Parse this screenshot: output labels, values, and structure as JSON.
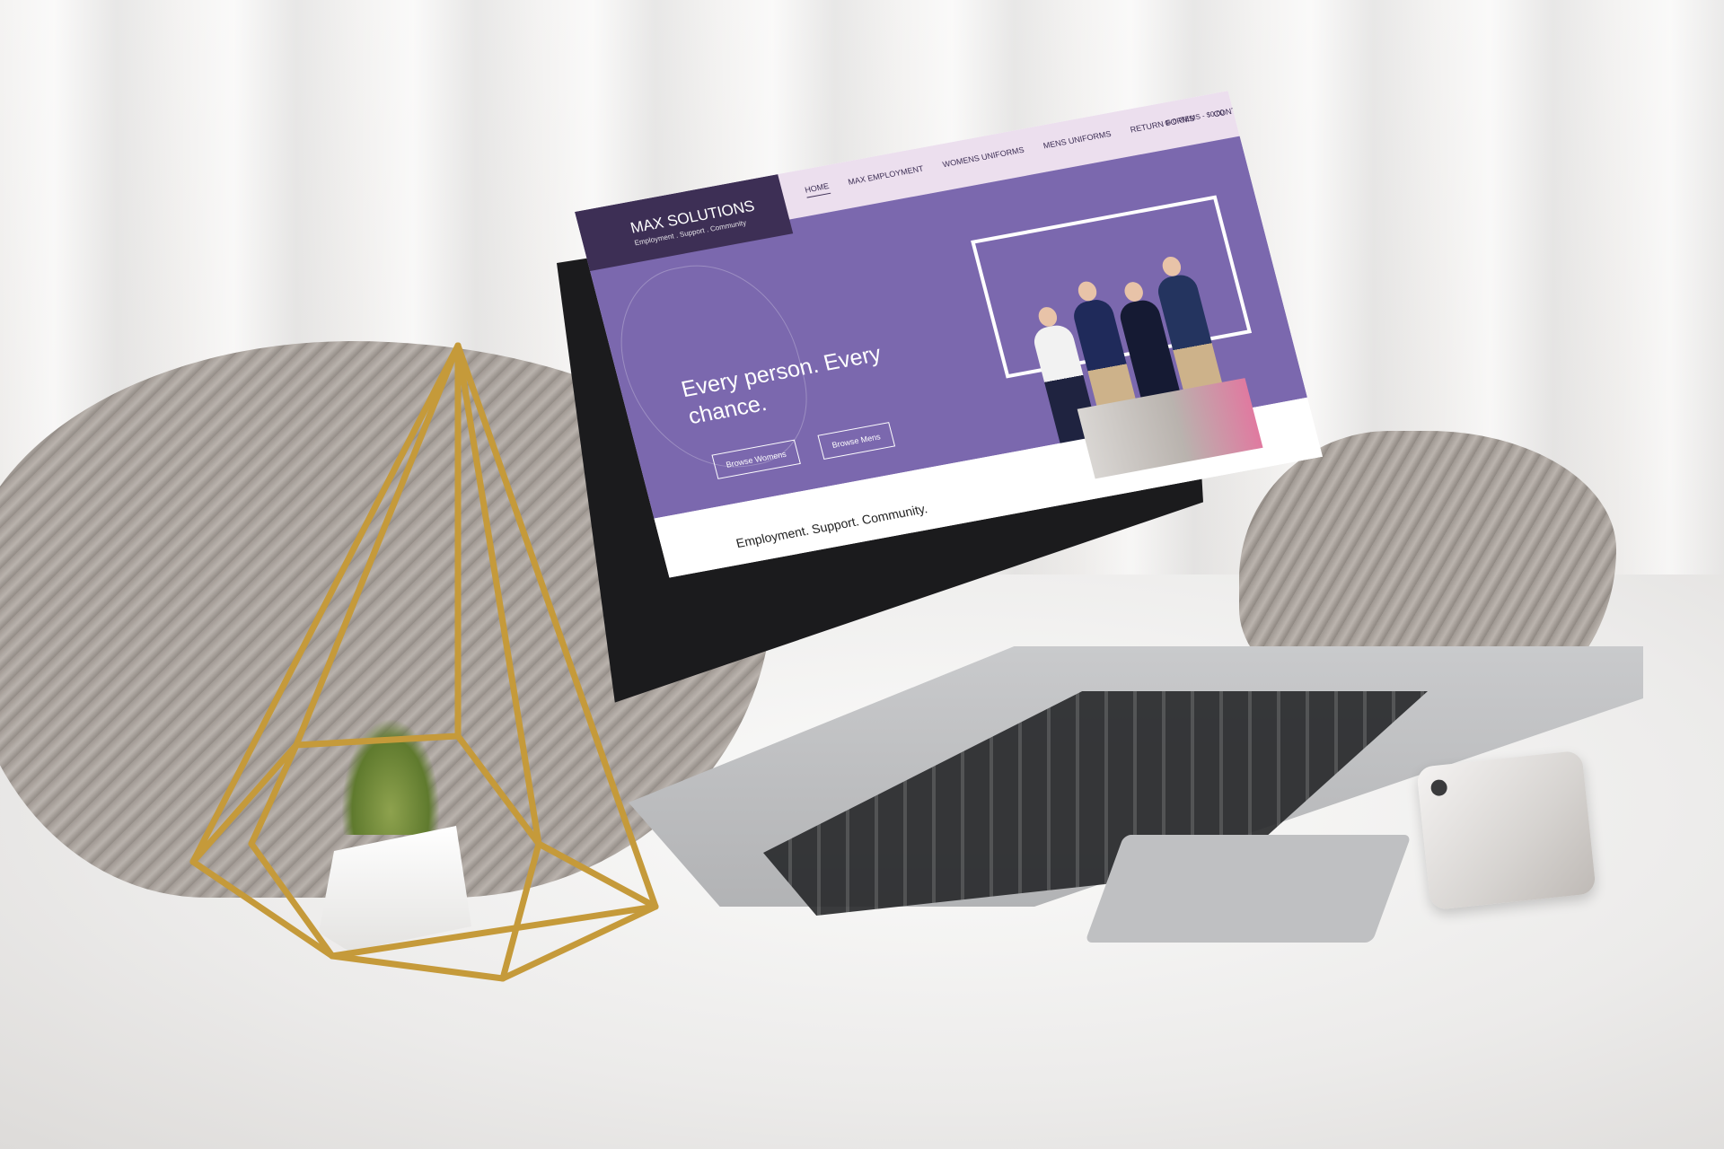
{
  "website": {
    "brand": {
      "name": "MAX SOLUTIONS",
      "tagline": "Employment . Support . Community"
    },
    "nav": [
      {
        "label": "HOME",
        "active": true
      },
      {
        "label": "MAX EMPLOYMENT",
        "active": false
      },
      {
        "label": "WOMENS UNIFORMS",
        "active": false
      },
      {
        "label": "MENS UNIFORMS",
        "active": false
      },
      {
        "label": "RETURN FORMS",
        "active": false
      },
      {
        "label": "CONTACT",
        "active": false
      }
    ],
    "cart": {
      "items": "0 ITEMS",
      "total": "$0.00"
    },
    "hero": {
      "headline": "Every person. Every chance.",
      "buttons": {
        "womens": "Browse Womens",
        "mens": "Browse Mens"
      }
    },
    "section_tagline": "Employment. Support. Community."
  },
  "colors": {
    "hero_purple": "#7b68ae",
    "brand_dark": "#3d2f55",
    "header_lilac": "#ecdfee",
    "accent_pink": "#e5668f"
  }
}
